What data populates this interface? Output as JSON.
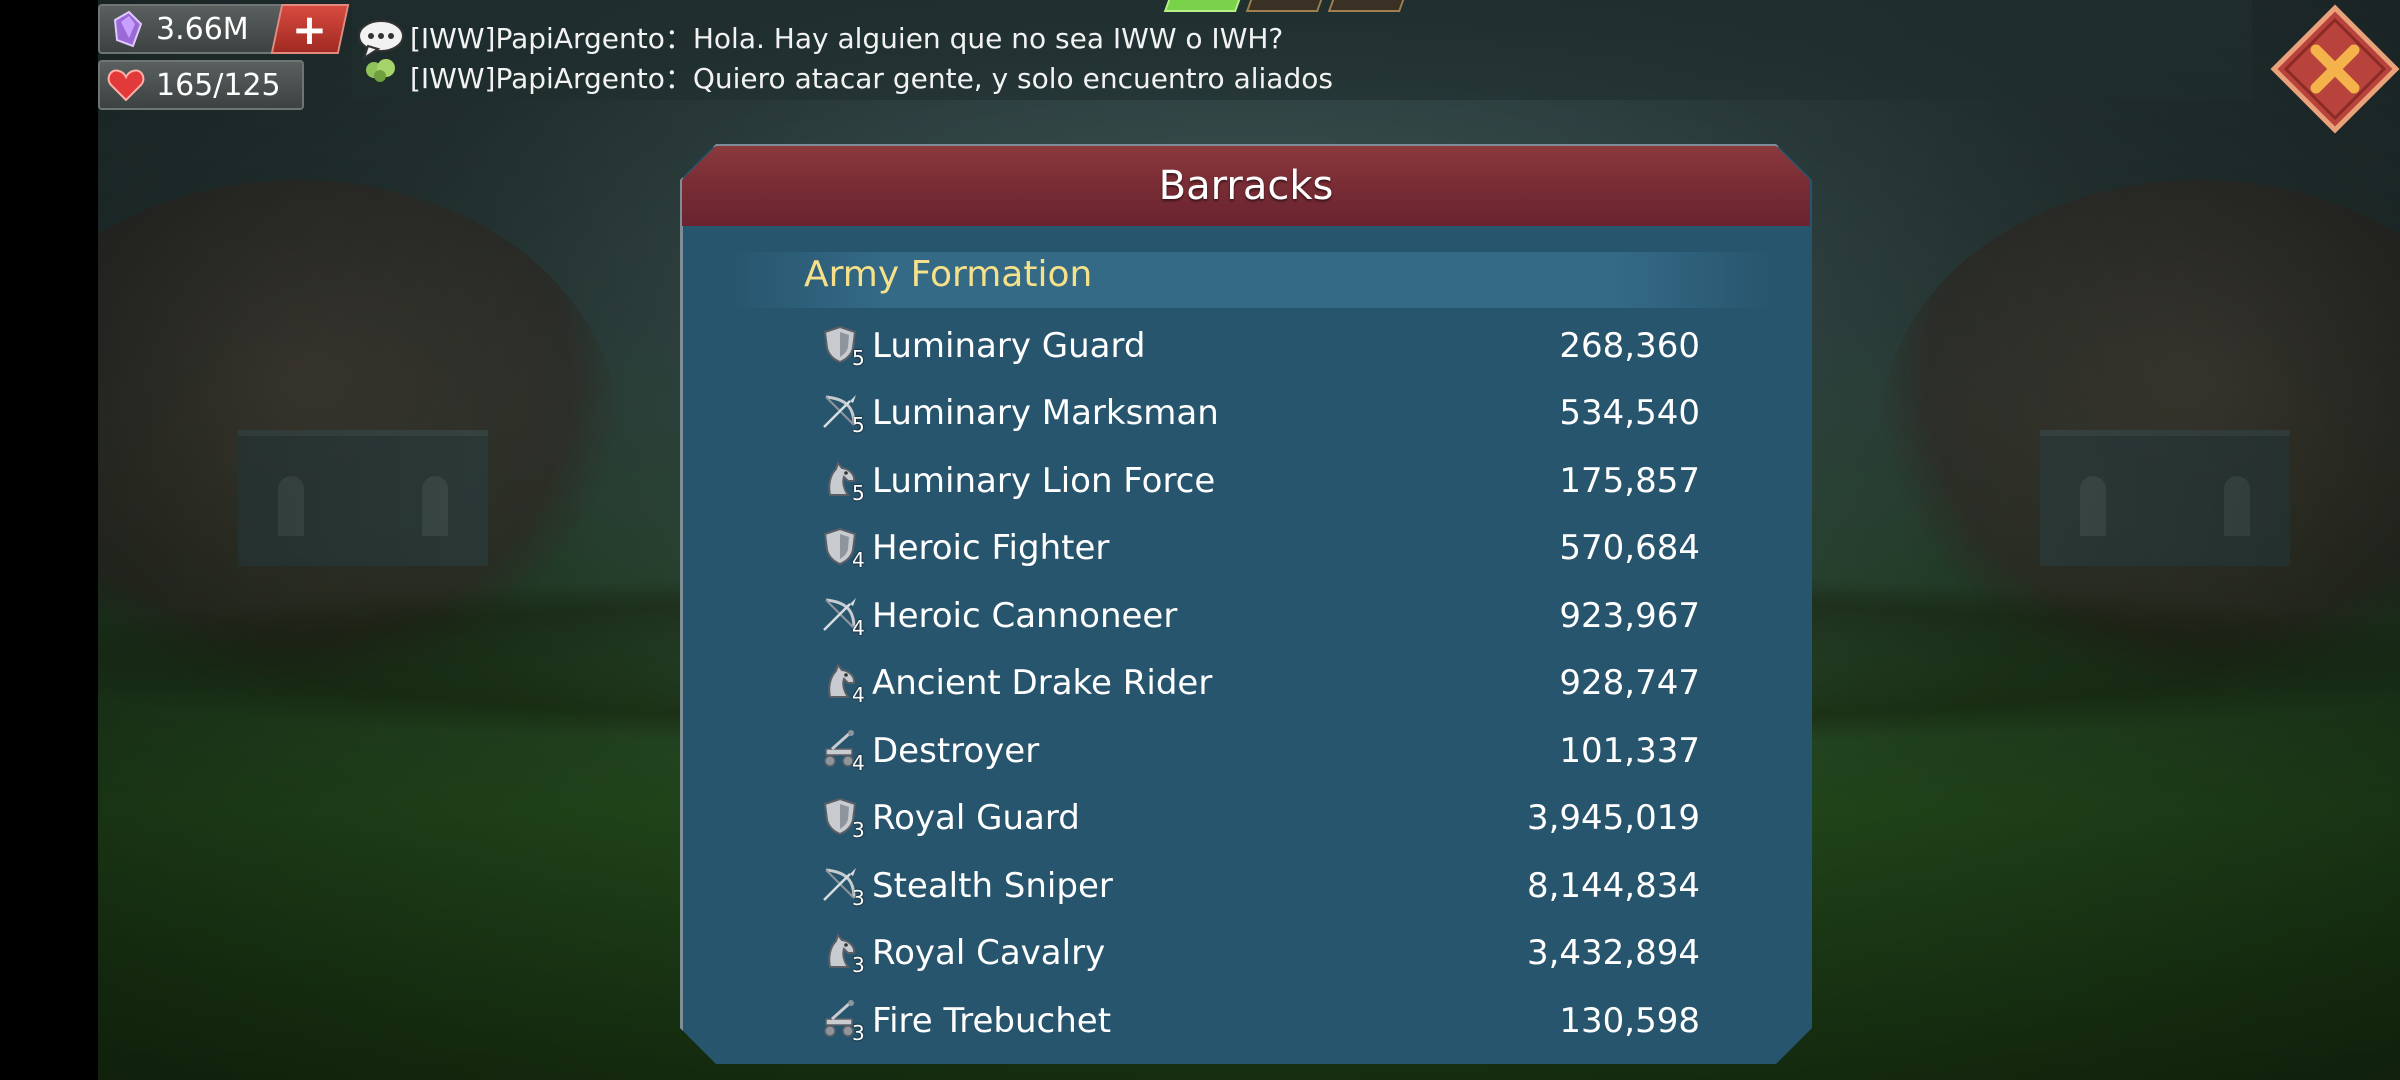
{
  "resources": {
    "gems": "3.66M",
    "health": "165/125"
  },
  "chat": {
    "messages": [
      {
        "sender": "[IWW]PapiArgento",
        "separator": "：",
        "text": "Hola. Hay alguien que no sea IWW o IWH?"
      },
      {
        "sender": "[IWW]PapiArgento",
        "separator": "：",
        "text": "Quiero atacar gente, y solo encuentro aliados"
      }
    ]
  },
  "panel": {
    "title": "Barracks",
    "section": "Army Formation",
    "troops": [
      {
        "type": "infantry-icon",
        "tier": "5",
        "name": "Luminary Guard",
        "count": "268,360"
      },
      {
        "type": "ranged-icon",
        "tier": "5",
        "name": "Luminary Marksman",
        "count": "534,540"
      },
      {
        "type": "cavalry-icon",
        "tier": "5",
        "name": "Luminary Lion Force",
        "count": "175,857"
      },
      {
        "type": "infantry-icon",
        "tier": "4",
        "name": "Heroic Fighter",
        "count": "570,684"
      },
      {
        "type": "ranged-icon",
        "tier": "4",
        "name": "Heroic Cannoneer",
        "count": "923,967"
      },
      {
        "type": "cavalry-icon",
        "tier": "4",
        "name": "Ancient Drake Rider",
        "count": "928,747"
      },
      {
        "type": "siege-icon",
        "tier": "4",
        "name": "Destroyer",
        "count": "101,337"
      },
      {
        "type": "infantry-icon",
        "tier": "3",
        "name": "Royal Guard",
        "count": "3,945,019"
      },
      {
        "type": "ranged-icon",
        "tier": "3",
        "name": "Stealth Sniper",
        "count": "8,144,834"
      },
      {
        "type": "cavalry-icon",
        "tier": "3",
        "name": "Royal Cavalry",
        "count": "3,432,894"
      },
      {
        "type": "siege-icon",
        "tier": "3",
        "name": "Fire Trebuchet",
        "count": "130,598"
      }
    ]
  },
  "colors": {
    "panel_bg": "#28556e",
    "header_red": "#7a2d35",
    "section_gold": "#f6e08a",
    "close_red": "#b7433c"
  }
}
